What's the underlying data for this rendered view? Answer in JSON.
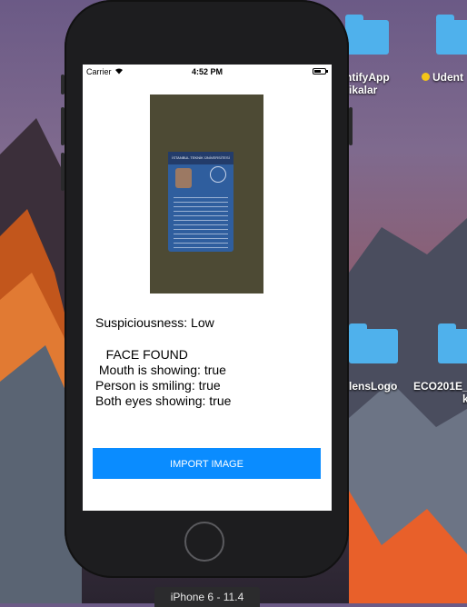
{
  "desktop": {
    "items": [
      {
        "label_lines": [
          "ntifyApp",
          "fikalar"
        ]
      },
      {
        "label_lines": [
          "Udent"
        ],
        "tag_color": "#f5c518"
      },
      {
        "label_lines": [
          "lensLogo"
        ]
      },
      {
        "label_lines": [
          "ECO201E_",
          "k"
        ]
      }
    ]
  },
  "status_bar": {
    "carrier": "Carrier",
    "time": "4:52 PM",
    "battery_level": 0.6
  },
  "app": {
    "suspiciousness": "Suspiciousness: Low",
    "results": "   FACE FOUND\n Mouth is showing: true\nPerson is smiling: true\nBoth eyes showing: true",
    "import_button": "IMPORT IMAGE",
    "card_header": "İSTANBUL TEKNİK ÜNİVERSİTESİ"
  },
  "simulator": {
    "label": "iPhone 6 - 11.4"
  },
  "colors": {
    "accent": "#0a8cff"
  }
}
